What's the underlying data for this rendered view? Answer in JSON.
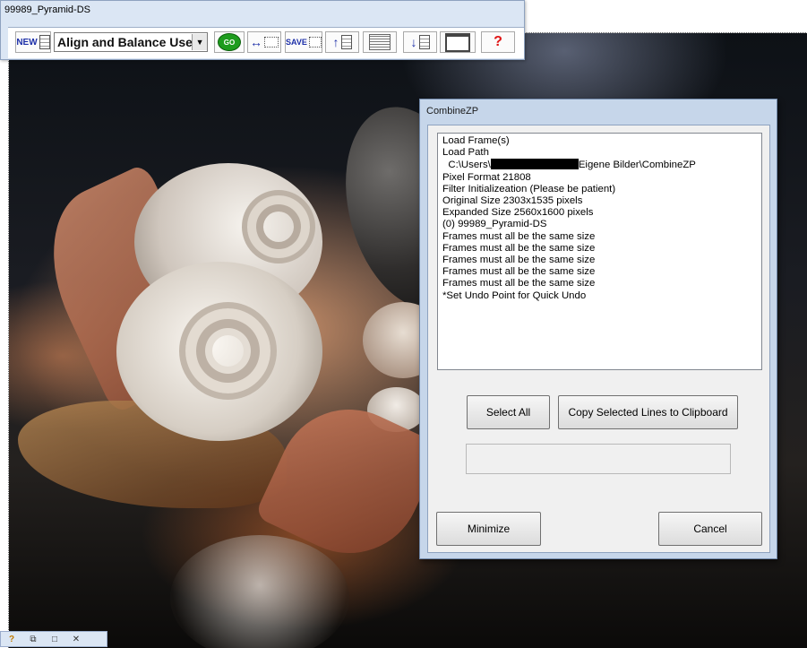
{
  "toolbar_window": {
    "title": "99989_Pyramid-DS",
    "new_label": "NEW",
    "macro_select_value": "Align and Balance Used Frames",
    "go_label": "GO",
    "swap_symbol": "↔",
    "save_label": "SAVE",
    "up_symbol": "↑",
    "down_symbol": "↓",
    "help_symbol": "?"
  },
  "dialog": {
    "title": "CombineZP",
    "log": {
      "line1": "Load Frame(s)",
      "line2": "Load Path",
      "path_prefix": "C:\\Users\\",
      "path_suffix": "Eigene Bilder\\CombineZP",
      "line4": "Pixel Format 21808",
      "line5": "Filter Initializeation (Please be patient)",
      "line6": "Original Size 2303x1535 pixels",
      "line7": "Expanded Size 2560x1600 pixels",
      "line8": "(0) 99989_Pyramid-DS",
      "line9": "Frames must all be the same size",
      "line10": "Frames must all be the same size",
      "line11": "Frames must all be the same size",
      "line12": "Frames must all be the same size",
      "line13": "Frames must all be the same size",
      "line14": "*Set Undo Point for Quick Undo"
    },
    "select_all_label": "Select All",
    "copy_label": "Copy Selected Lines to Clipboard",
    "progress_percent": 0,
    "minimize_label": "Minimize",
    "cancel_label": "Cancel"
  },
  "mdi_controls": {
    "help_icon": "help-icon",
    "restore_icon": "restore-icon",
    "maximize_icon": "maximize-icon",
    "close_icon": "close-icon"
  }
}
